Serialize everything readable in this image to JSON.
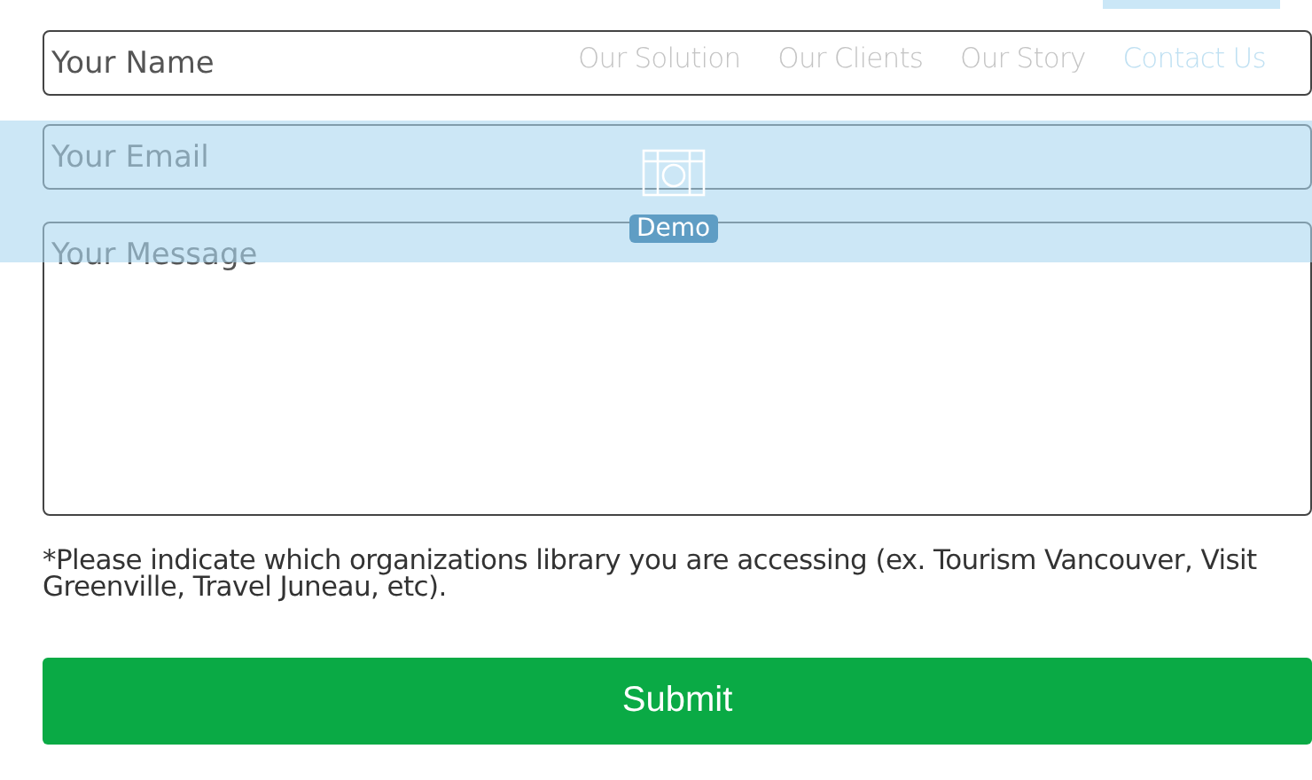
{
  "nav": {
    "items": [
      {
        "label": "Our Solution",
        "selected": false
      },
      {
        "label": "Our Clients",
        "selected": false
      },
      {
        "label": "Our Story",
        "selected": false
      },
      {
        "label": "Contact Us",
        "selected": true
      }
    ],
    "demo": {
      "label": "Demo"
    }
  },
  "form": {
    "fields": [
      {
        "kind": "line",
        "placeholder": "Your Name"
      },
      {
        "kind": "line",
        "placeholder": "Your Email"
      },
      {
        "kind": "area",
        "placeholder": "Your Message"
      }
    ],
    "note": "*Please indicate which organizations library you are accessing (ex. Tourism Vancouver, Visit Greenville, Travel Juneau, etc).",
    "submit": "Submit"
  }
}
